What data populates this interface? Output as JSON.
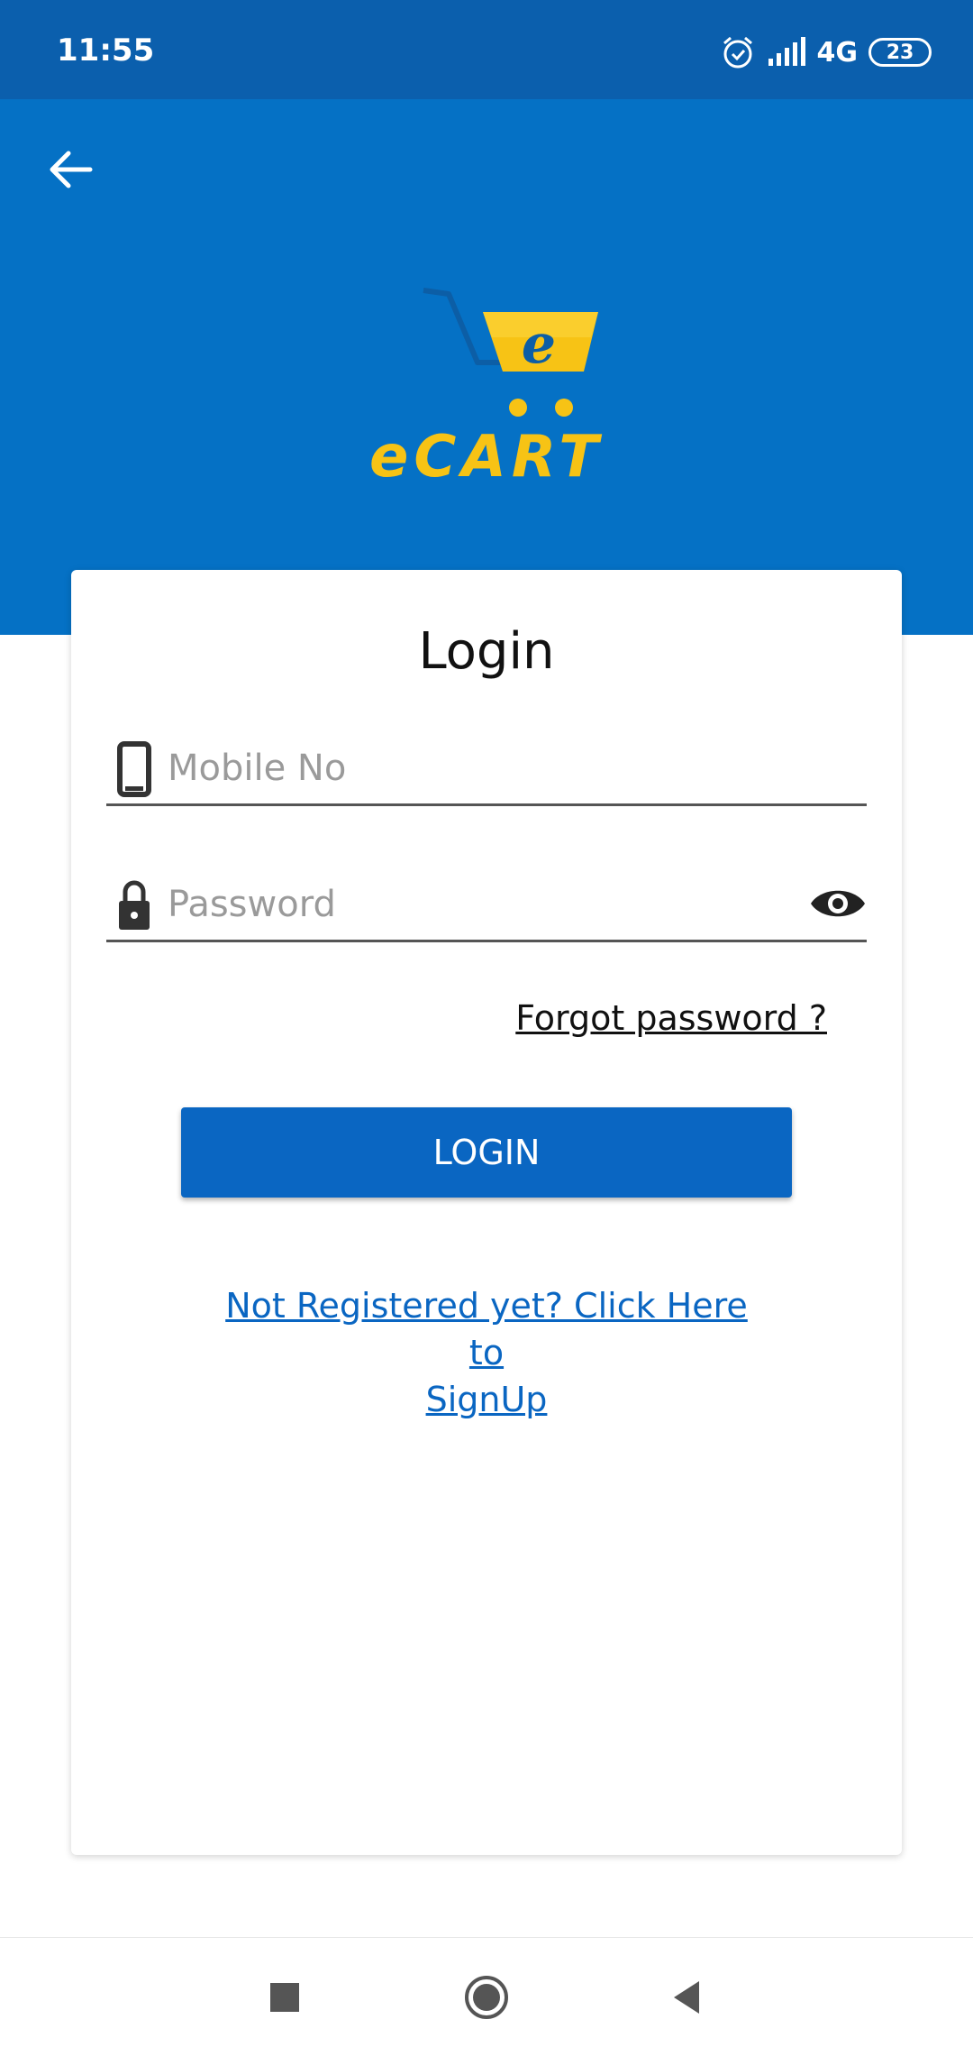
{
  "status_bar": {
    "time": "11:55",
    "network": "4G",
    "battery": "23"
  },
  "header": {
    "logo_text": "eCART",
    "logo_emblem_letter": "e",
    "colors": {
      "primary": "#0571c5",
      "logo_yellow": "#f7c315"
    }
  },
  "login": {
    "title": "Login",
    "mobile_placeholder": "Mobile No",
    "password_placeholder": "Password",
    "forgot_label": "Forgot password ?",
    "login_button": "LOGIN",
    "signup_line1": "Not Registered yet? Click Here to",
    "signup_line2": "SignUp"
  },
  "icons": {
    "back": "arrow-left-icon",
    "mobile": "phone-icon",
    "password": "lock-icon",
    "visibility": "eye-icon",
    "nav_recents": "square-icon",
    "nav_home": "circle-icon",
    "nav_back": "triangle-icon"
  }
}
